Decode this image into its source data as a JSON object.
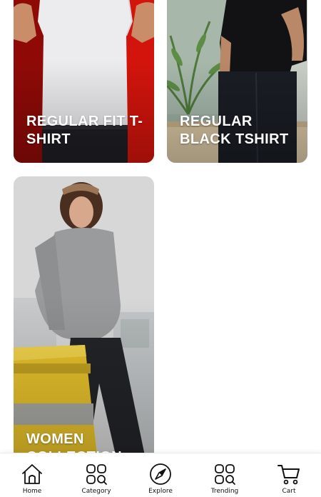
{
  "products": [
    {
      "title": "REGULAR FIT T-SHIRT"
    },
    {
      "title": "REGULAR BLACK TSHIRT"
    },
    {
      "title": "WOMEN COLLECTION"
    }
  ],
  "nav": {
    "items": [
      {
        "label": "Home",
        "icon": "home-icon"
      },
      {
        "label": "Category",
        "icon": "category-icon"
      },
      {
        "label": "Explore",
        "icon": "compass-icon"
      },
      {
        "label": "Trending",
        "icon": "trending-icon"
      },
      {
        "label": "Cart",
        "icon": "cart-icon"
      }
    ]
  },
  "colors": {
    "accent_red": "#d3140c",
    "sweater_gray": "#9a9b9c",
    "bag_yellow": "#e8c22b"
  }
}
